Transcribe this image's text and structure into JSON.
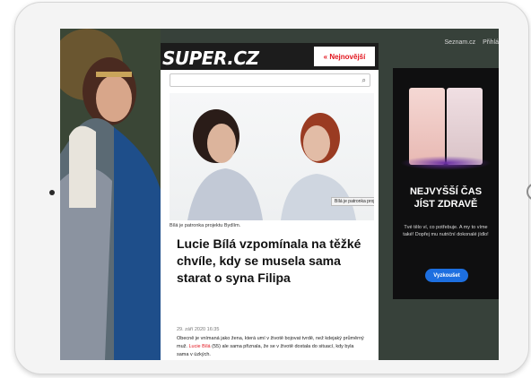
{
  "site": {
    "logo": "SUPER.CZ",
    "newest_label": "« Nejnovější",
    "top_links": [
      "Seznam.cz",
      "Přihlá"
    ]
  },
  "article": {
    "photo_tooltip": "Bílá je patronka projektu Bydlím.",
    "caption": "Bílá je patronka projektu Bydlím.",
    "headline": "Lucie Bílá vzpomínala na těžké chvíle, kdy se musela sama starat o syna Filipa",
    "date": "29. září 2020 16:35",
    "perex_before": "Obecně je vnímaná jako žena, která umí v životě bojovat tvrdě, než kdejaký průměrný muž. ",
    "perex_link": "Lucie Bílá",
    "perex_after": " (55) ale sama přiznala, že se v životě dostala do situací, kdy byla sama v úzkých."
  },
  "ad": {
    "title_line1": "NEJVYŠŠÍ ČAS",
    "title_line2": "JÍST ZDRAVĚ",
    "subtitle": "Tvé tělo ví, co potřebuje. A my to víme také! Dopřej mu nutriční dokonalé jídlo!",
    "button": "Vyzkoušet"
  },
  "icons": {
    "search": "search-icon"
  }
}
